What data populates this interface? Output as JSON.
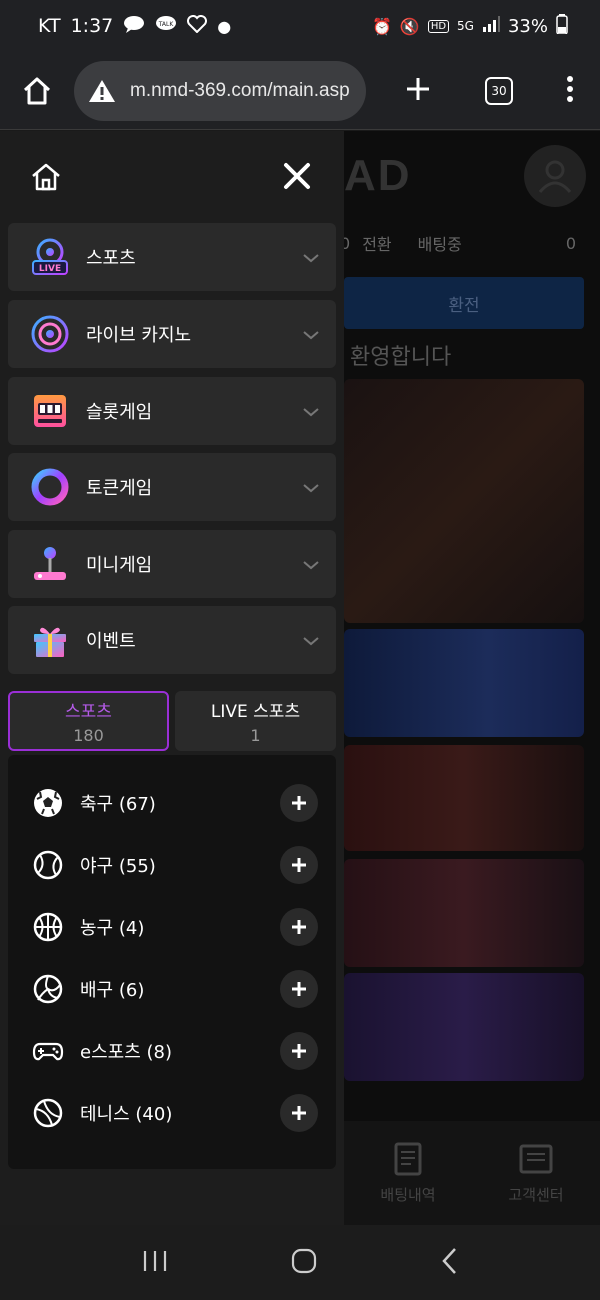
{
  "status": {
    "carrier": "KT",
    "time": "1:37",
    "network": "5G",
    "battery": "33%"
  },
  "browser": {
    "url": "m.nmd-369.com/main.asp",
    "tab_count": "30"
  },
  "background": {
    "logo": "AD",
    "stats_label_1": "전환",
    "stats_value_0": "0",
    "stats_label_2": "배팅중",
    "stats_value_2": "0",
    "convert_button": "환전",
    "welcome": "환영합니다",
    "nav_bet_history": "배팅내역",
    "nav_support": "고객센터"
  },
  "drawer": {
    "menu": [
      {
        "label": "스포츠",
        "icon": "live-sports-icon"
      },
      {
        "label": "라이브 카지노",
        "icon": "casino-chip-icon"
      },
      {
        "label": "슬롯게임",
        "icon": "slot-machine-icon"
      },
      {
        "label": "토큰게임",
        "icon": "token-ring-icon"
      },
      {
        "label": "미니게임",
        "icon": "joystick-icon"
      },
      {
        "label": "이벤트",
        "icon": "gift-icon"
      }
    ],
    "tabs": [
      {
        "label": "스포츠",
        "count": "180",
        "active": true
      },
      {
        "label": "LIVE 스포츠",
        "count": "1",
        "active": false
      }
    ],
    "sports": [
      {
        "label": "축구 (67)",
        "icon": "soccer-ball-icon"
      },
      {
        "label": "야구 (55)",
        "icon": "baseball-icon"
      },
      {
        "label": "농구 (4)",
        "icon": "basketball-icon"
      },
      {
        "label": "배구 (6)",
        "icon": "volleyball-icon"
      },
      {
        "label": "e스포츠 (8)",
        "icon": "gamepad-icon"
      },
      {
        "label": "테니스 (40)",
        "icon": "tennis-ball-icon"
      }
    ]
  },
  "colors": {
    "accent": "#9a2fd6",
    "accent_text": "#b45ae8"
  }
}
